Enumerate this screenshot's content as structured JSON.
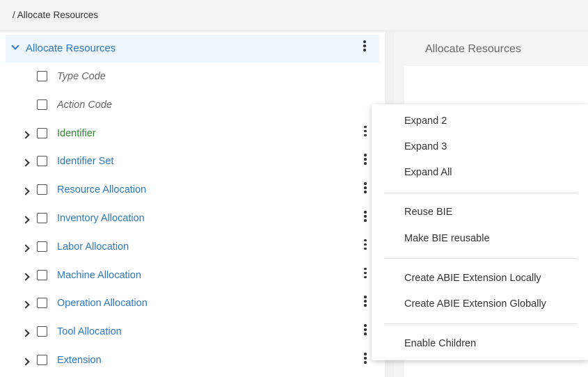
{
  "breadcrumb": "/ Allocate Resources",
  "tree": {
    "root": {
      "label": "Allocate Resources"
    },
    "items": [
      {
        "label": "Type Code",
        "style": "italic",
        "expandable": false,
        "menu": false
      },
      {
        "label": "Action Code",
        "style": "italic",
        "expandable": false,
        "menu": false
      },
      {
        "label": "Identifier",
        "style": "green",
        "expandable": true,
        "menu": true
      },
      {
        "label": "Identifier Set",
        "style": "blue",
        "expandable": true,
        "menu": true
      },
      {
        "label": "Resource Allocation",
        "style": "blue",
        "expandable": true,
        "menu": true
      },
      {
        "label": "Inventory Allocation",
        "style": "blue",
        "expandable": true,
        "menu": true
      },
      {
        "label": "Labor Allocation",
        "style": "blue",
        "expandable": true,
        "menu": true
      },
      {
        "label": "Machine Allocation",
        "style": "blue",
        "expandable": true,
        "menu": true
      },
      {
        "label": "Operation Allocation",
        "style": "blue",
        "expandable": true,
        "menu": true
      },
      {
        "label": "Tool Allocation",
        "style": "blue",
        "expandable": true,
        "menu": true
      },
      {
        "label": "Extension",
        "style": "blue",
        "expandable": true,
        "menu": true
      }
    ]
  },
  "detail": {
    "title": "Allocate Resources"
  },
  "context_menu": {
    "groups": [
      [
        "Expand 2",
        "Expand 3",
        "Expand All"
      ],
      [
        "Reuse BIE",
        "Make BIE reusable"
      ],
      [
        "Create ABIE Extension Locally",
        "Create ABIE Extension Globally"
      ],
      [
        "Enable Children"
      ]
    ]
  },
  "colors": {
    "link_blue": "#2b78c2",
    "green": "#2f8a2f",
    "selected_row": "#eef5fb"
  },
  "icons": {
    "expand": "chevron-down-icon",
    "collapse": "chevron-right-icon",
    "more": "kebab-menu-icon"
  }
}
